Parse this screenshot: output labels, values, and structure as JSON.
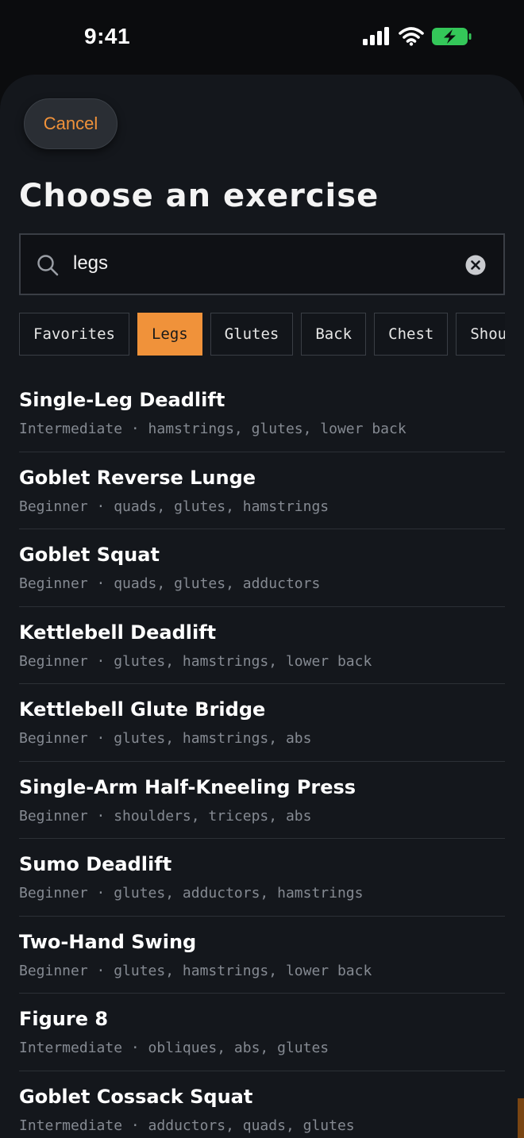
{
  "status_bar": {
    "time": "9:41"
  },
  "cancel_label": "Cancel",
  "title": "Choose an exercise",
  "search": {
    "value": "legs",
    "placeholder": ""
  },
  "filters": [
    "Favorites",
    "Legs",
    "Glutes",
    "Back",
    "Chest",
    "Shoulders"
  ],
  "active_filter": "Legs",
  "exercises": [
    {
      "name": "Single-Leg Deadlift",
      "meta": "Intermediate · hamstrings, glutes, lower back"
    },
    {
      "name": "Goblet Reverse Lunge",
      "meta": "Beginner · quads, glutes, hamstrings"
    },
    {
      "name": "Goblet Squat",
      "meta": "Beginner · quads, glutes, adductors"
    },
    {
      "name": "Kettlebell Deadlift",
      "meta": "Beginner · glutes, hamstrings, lower back"
    },
    {
      "name": "Kettlebell Glute Bridge",
      "meta": "Beginner · glutes, hamstrings, abs"
    },
    {
      "name": "Single-Arm Half-Kneeling Press",
      "meta": "Beginner · shoulders, triceps, abs"
    },
    {
      "name": "Sumo Deadlift",
      "meta": "Beginner · glutes, adductors, hamstrings"
    },
    {
      "name": "Two-Hand Swing",
      "meta": "Beginner · glutes, hamstrings, lower back"
    },
    {
      "name": "Figure 8",
      "meta": "Intermediate · obliques, abs, glutes"
    },
    {
      "name": "Goblet Cossack Squat",
      "meta": "Intermediate · adductors, quads, glutes"
    }
  ],
  "colors": {
    "accent": "#f0923a",
    "background": "#0b0c0e",
    "sheet": "#14171c",
    "battery": "#34c759"
  }
}
